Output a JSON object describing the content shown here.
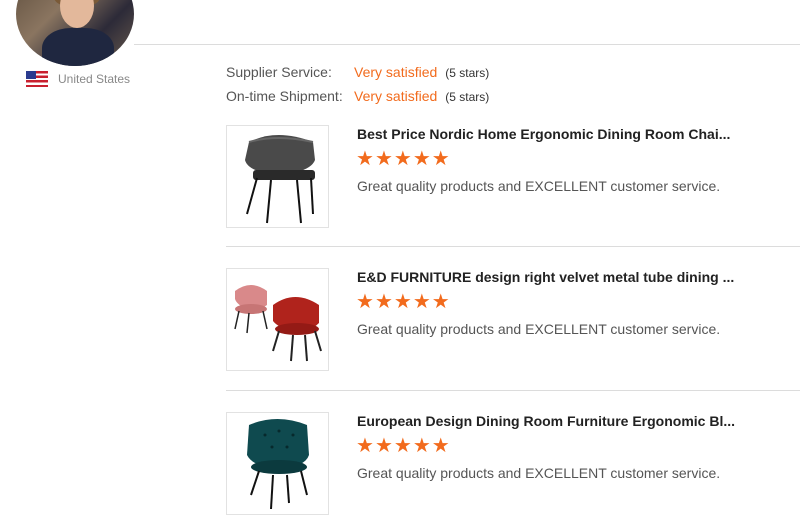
{
  "reviewer": {
    "country": "United States",
    "avatar": "avatar-photo",
    "flag": "us-flag-icon"
  },
  "ratings": [
    {
      "label": "Supplier Service:",
      "value": "Very satisfied",
      "stars": "(5 stars)"
    },
    {
      "label": "On-time Shipment:",
      "value": "Very satisfied",
      "stars": "(5 stars)"
    }
  ],
  "reviews": [
    {
      "title": "Best Price Nordic Home Ergonomic Dining Room Chai...",
      "rating": 5,
      "comment": "Great quality products and EXCELLENT customer service.",
      "image": "chair-gray-icon"
    },
    {
      "title": "E&D FURNITURE design right velvet metal tube dining ...",
      "rating": 5,
      "comment": "Great quality products and EXCELLENT customer service.",
      "image": "chair-red-pink-icon"
    },
    {
      "title": "European Design Dining Room Furniture Ergonomic Bl...",
      "rating": 5,
      "comment": "Great quality products and EXCELLENT customer service.",
      "image": "chair-teal-icon"
    }
  ],
  "colors": {
    "accent": "#f26b1d",
    "divider": "#dcdcdc"
  }
}
